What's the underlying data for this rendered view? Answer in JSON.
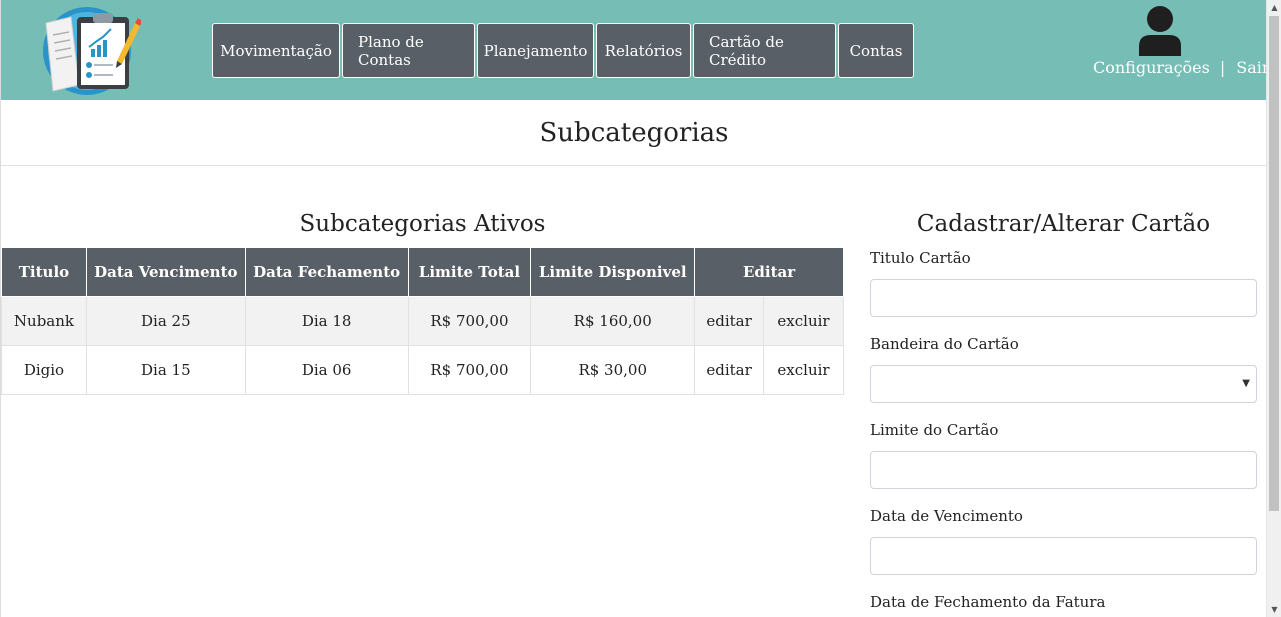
{
  "nav": {
    "items": [
      {
        "label": "Movimentação"
      },
      {
        "label": "Plano de Contas"
      },
      {
        "label": "Planejamento"
      },
      {
        "label": "Relatórios"
      },
      {
        "label": "Cartão de Crédito"
      },
      {
        "label": "Contas"
      }
    ]
  },
  "user": {
    "settings_label": "Configurações",
    "separator": "|",
    "logout_label": "Sair"
  },
  "page_title": "Subcategorias",
  "table_section": {
    "title": "Subcategorias Ativos",
    "headers": [
      "Titulo",
      "Data Vencimento",
      "Data Fechamento",
      "Limite Total",
      "Limite Disponivel",
      "Editar"
    ],
    "rows": [
      {
        "titulo": "Nubank",
        "vencimento": "Dia 25",
        "fechamento": "Dia 18",
        "limite_total": "R$ 700,00",
        "limite_disponivel": "R$ 160,00",
        "edit": "editar",
        "delete": "excluir"
      },
      {
        "titulo": "Digio",
        "vencimento": "Dia 15",
        "fechamento": "Dia 06",
        "limite_total": "R$ 700,00",
        "limite_disponivel": "R$ 30,00",
        "edit": "editar",
        "delete": "excluir"
      }
    ]
  },
  "form": {
    "title": "Cadastrar/Alterar Cartão",
    "titulo_label": "Titulo Cartão",
    "titulo_value": "",
    "bandeira_label": "Bandeira do Cartão",
    "bandeira_value": "",
    "limite_label": "Limite do Cartão",
    "limite_value": "",
    "vencimento_label": "Data de Vencimento",
    "vencimento_value": "",
    "fechamento_label": "Data de Fechamento da Fatura"
  },
  "colors": {
    "header_bg": "#75bdb5",
    "nav_button_bg": "#595f66",
    "table_header_bg": "#595f66",
    "row_alt_bg": "#f2f2f2"
  }
}
